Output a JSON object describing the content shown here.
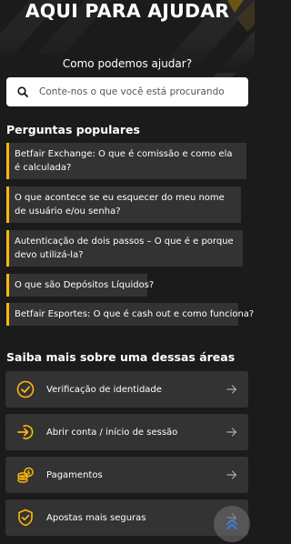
{
  "hero": {
    "title": "AQUI PARA AJUDAR",
    "subtitle": "Como podemos ajudar?"
  },
  "search": {
    "placeholder": "Conte-nos o que você está procurando",
    "value": ""
  },
  "popular": {
    "title": "Perguntas populares",
    "questions": [
      "Betfair Exchange: O que é comissão e como ela é calculada?",
      "O que acontece se eu esquecer do meu nome de usuário e/ou senha?",
      "Autenticação de dois passos – O que é e porque devo utilizá-la?",
      "O que são Depósitos Líquidos?",
      "Betfair Esportes: O que é cash out e como funciona?"
    ]
  },
  "areas": {
    "title": "Saiba mais sobre uma dessas áreas",
    "items": [
      {
        "label": "Verificação de identidade",
        "icon": "check-circle-icon"
      },
      {
        "label": "Abrir conta / início de sessão",
        "icon": "login-icon"
      },
      {
        "label": "Pagamentos",
        "icon": "coins-icon"
      },
      {
        "label": "Apostas mais seguras",
        "icon": "shield-check-icon"
      }
    ]
  },
  "colors": {
    "background": "#1b1b1b",
    "card": "#333333",
    "accent": "#ffb80c"
  }
}
